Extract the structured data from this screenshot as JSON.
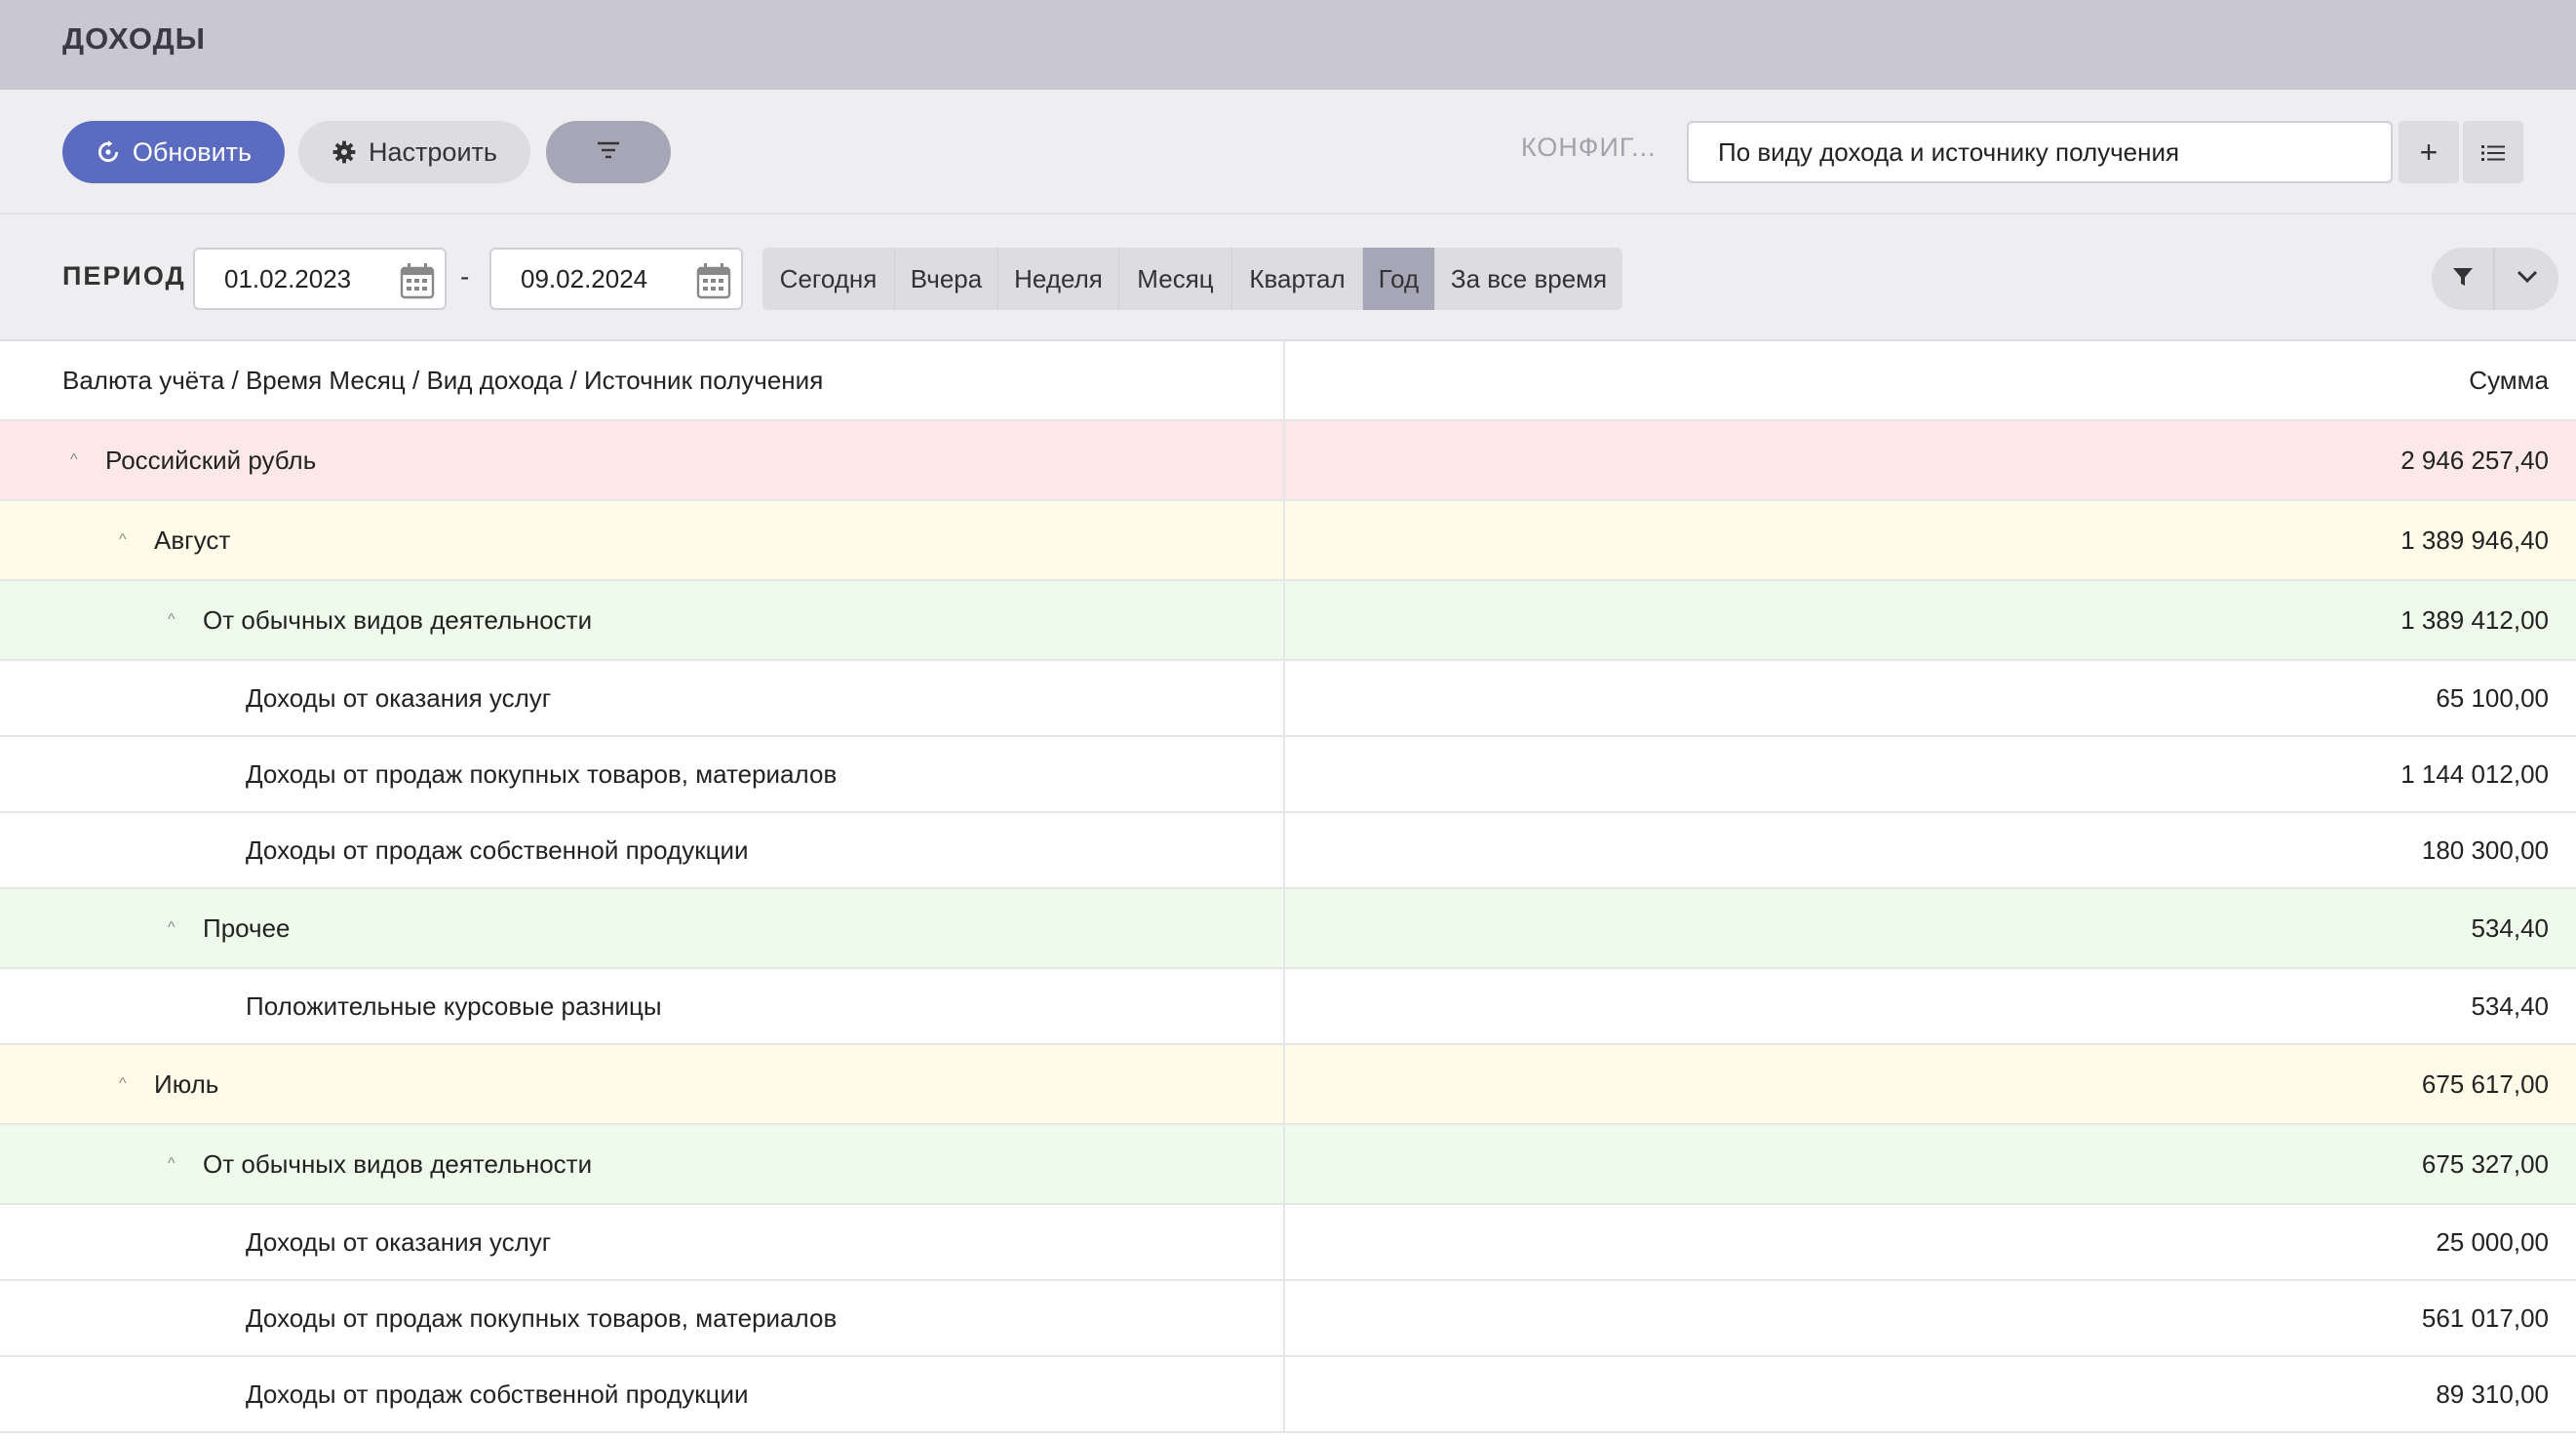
{
  "header": {
    "title": "ДОХОДЫ"
  },
  "toolbar": {
    "refresh_label": "Обновить",
    "configure_label": "Настроить",
    "config_label": "КОНФИГ...",
    "config_value": "По виду дохода и источнику получения",
    "add_symbol": "+",
    "accent_color": "#5b6bbf"
  },
  "period": {
    "label": "ПЕРИОД",
    "from": "01.02.2023",
    "separator": "-",
    "to": "09.02.2024",
    "presets": [
      "Сегодня",
      "Вчера",
      "Неделя",
      "Месяц",
      "Квартал",
      "Год",
      "За все время"
    ],
    "active_preset": "Год"
  },
  "table": {
    "col1_header": "Валюта учёта / Время Месяц / Вид дохода / Источник получения",
    "col2_header": "Сумма",
    "rows": [
      {
        "label": "Российский рубль",
        "amount": "2 946 257,40"
      },
      {
        "label": "Август",
        "amount": "1 389 946,40"
      },
      {
        "label": "От обычных видов деятельности",
        "amount": "1 389 412,00"
      },
      {
        "label": "Доходы от оказания услуг",
        "amount": "65 100,00"
      },
      {
        "label": "Доходы от продаж покупных товаров, материалов",
        "amount": "1 144 012,00"
      },
      {
        "label": "Доходы от продаж собственной продукции",
        "amount": "180 300,00"
      },
      {
        "label": "Прочее",
        "amount": "534,40"
      },
      {
        "label": "Положительные курсовые разницы",
        "amount": "534,40"
      },
      {
        "label": "Июль",
        "amount": "675 617,00"
      },
      {
        "label": "От обычных видов деятельности",
        "amount": "675 327,00"
      },
      {
        "label": "Доходы от оказания услуг",
        "amount": "25 000,00"
      },
      {
        "label": "Доходы от продаж покупных товаров, материалов",
        "amount": "561 017,00"
      },
      {
        "label": "Доходы от продаж собственной продукции",
        "amount": "89 310,00"
      }
    ]
  }
}
